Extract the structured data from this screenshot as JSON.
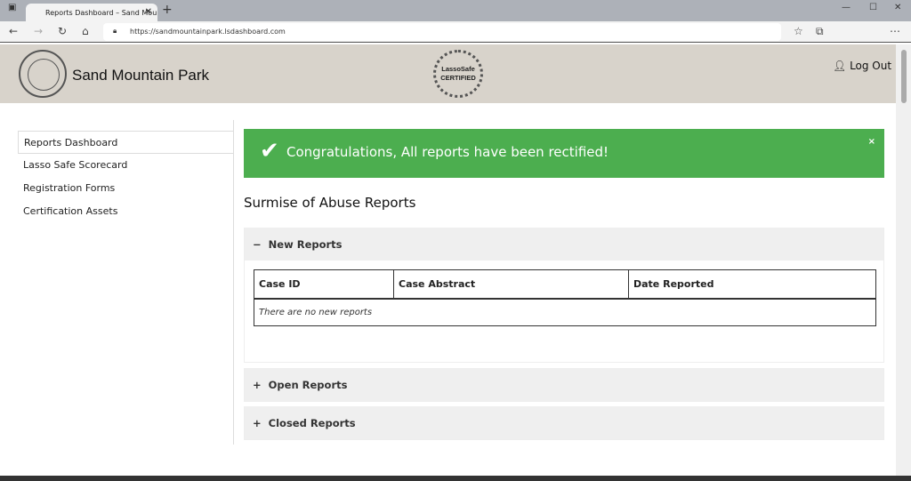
{
  "browser": {
    "tab_title": "Reports Dashboard – Sand Moun",
    "url": "https://sandmountainpark.lsdashboard.com"
  },
  "header": {
    "site_name": "Sand Mountain Park",
    "logo_text": "SAND MOUNTAIN PARK & AMPHITHEATER",
    "cert_text": "LassoSafe CERTIFIED",
    "logout": "Log Out"
  },
  "sidebar": {
    "items": [
      {
        "label": "Reports Dashboard"
      },
      {
        "label": "Lasso Safe Scorecard"
      },
      {
        "label": "Registration Forms"
      },
      {
        "label": "Certification Assets"
      }
    ]
  },
  "alert": {
    "message": "Congratulations, All reports have been rectified!",
    "close": "×",
    "color": "#4cae4f"
  },
  "main": {
    "title": "Surmise of Abuse Reports",
    "panels": [
      {
        "label": "New Reports",
        "icon": "−"
      },
      {
        "label": "Open Reports",
        "icon": "+"
      },
      {
        "label": "Closed Reports",
        "icon": "+"
      }
    ],
    "table": {
      "headers": [
        "Case ID",
        "Case Abstract",
        "Date Reported"
      ],
      "empty": "There are no new reports"
    }
  }
}
